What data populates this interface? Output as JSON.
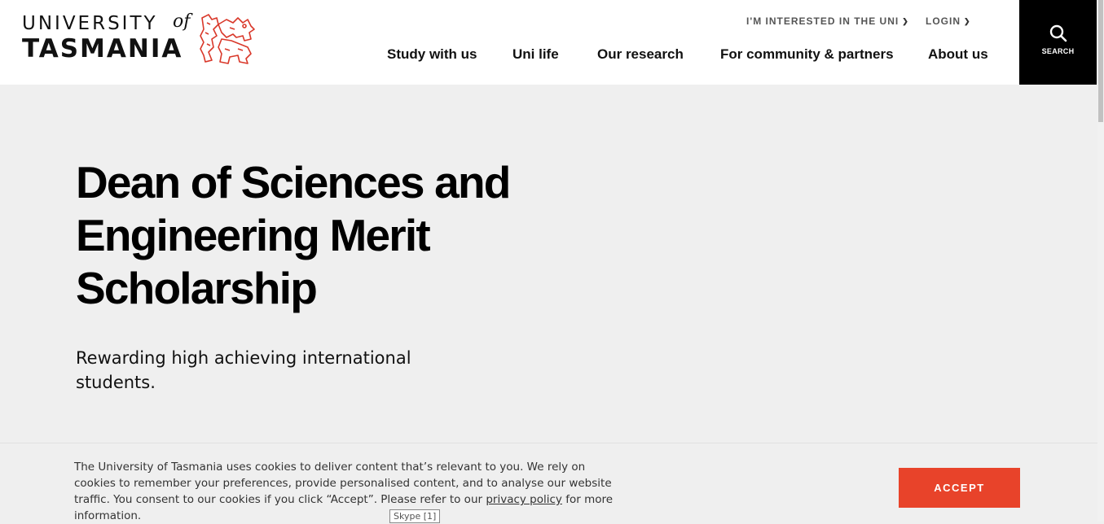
{
  "header": {
    "logo": {
      "line1": "UNIVERSITY",
      "of": "of",
      "line2": "TASMANIA"
    },
    "utility": [
      {
        "label": "I'M INTERESTED IN THE UNI",
        "icon": "chevron-down-icon"
      },
      {
        "label": "LOGIN",
        "icon": "chevron-down-icon"
      }
    ],
    "nav": [
      {
        "label": "Study with us"
      },
      {
        "label": "Uni life"
      },
      {
        "label": "Our research"
      },
      {
        "label": "For community & partners"
      },
      {
        "label": "About us"
      }
    ],
    "search": {
      "label": "SEARCH",
      "icon": "search-icon"
    }
  },
  "hero": {
    "title": "Dean of Sciences and Engineering Merit Scholarship",
    "subtitle": "Rewarding high achieving international students."
  },
  "cookie": {
    "text_before": "The University of Tasmania uses cookies to deliver content that’s relevant to you. We rely on cookies to remember your preferences, provide personalised content, and to analyse our website traffic. You consent to our cookies if you click “Accept”. Please refer to our ",
    "link": "privacy policy",
    "text_after": " for more information.",
    "accept": "ACCEPT"
  },
  "tooltip": {
    "text": "Skype [1]"
  },
  "colors": {
    "accent": "#e8432a",
    "search_bg": "#000000",
    "page_bg": "#efefef",
    "logo_lion": "#d9382a"
  }
}
